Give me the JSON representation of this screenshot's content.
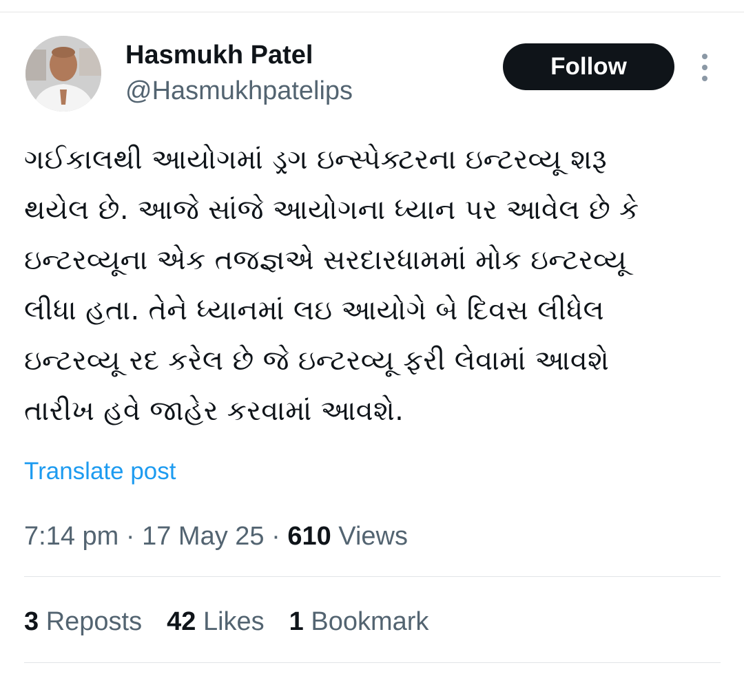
{
  "author": {
    "name": "Hasmukh Patel",
    "handle": "@Hasmukhpatelips"
  },
  "follow_label": "Follow",
  "tweet_text": "ગઈકાલથી આયોગમાં ડ્રગ ઇન્સ્પેક્ટરના ઇન્ટરવ્યૂ શરૂ\nથયેલ છે. આજે સાંજે આયોગના ધ્યાન પર આવેલ છે કે\nઇન્ટરવ્યૂના એક તજજ્ઞએ સરદારધામમાં મોક ઇન્ટરવ્યૂ\nલીધા હતા. તેને ધ્યાનમાં લઇ આયોગે બે દિવસ લીધેલ\nઇન્ટરવ્યૂ રદ કરેલ છે જે ઇન્ટરવ્યૂ ફરી લેવામાં આવશે\nતારીખ હવે જાહેર કરવામાં આવશે.",
  "translate_label": "Translate post",
  "meta": {
    "time": "7:14 pm",
    "sep1": " · ",
    "date": "17 May 25",
    "sep2": " · ",
    "views_count": "610",
    "views_label": " Views"
  },
  "stats": {
    "reposts_count": "3",
    "reposts_label": " Reposts",
    "likes_count": "42",
    "likes_label": " Likes",
    "bookmarks_count": "1",
    "bookmarks_label": " Bookmark"
  },
  "colors": {
    "link": "#1d9bf0",
    "muted": "#536471",
    "text": "#0f1419",
    "follow_bg": "#0f1419"
  }
}
